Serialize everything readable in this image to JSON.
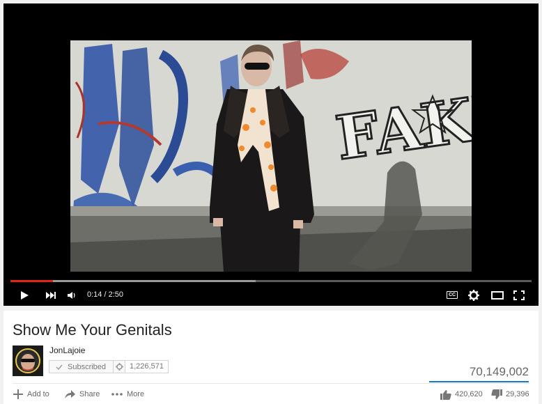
{
  "player": {
    "current_time": "0:14",
    "separator": "/",
    "duration": "2:50",
    "progress_played": 0.082,
    "progress_buffered": 0.47,
    "cc_label": "CC",
    "overlay_text": "FAKE"
  },
  "video": {
    "title": "Show Me Your Genitals",
    "channel_name": "JonLajoie",
    "subscribe_label": "Subscribed",
    "subscriber_count": "1,226,571",
    "view_count": "70,149,002",
    "likes": "420,620",
    "dislikes": "29,396"
  },
  "actions": {
    "add_to_label": "Add to",
    "share_label": "Share",
    "more_label": "More"
  },
  "colors": {
    "progress_red": "#e62117",
    "accent_blue": "#167ac6"
  },
  "icons": [
    "play-icon",
    "next-icon",
    "volume-icon",
    "cc-icon",
    "gear-icon",
    "theater-icon",
    "fullscreen-icon",
    "plus-icon",
    "share-icon",
    "more-icon",
    "thumbs-up-icon",
    "thumbs-down-icon",
    "check-icon"
  ]
}
